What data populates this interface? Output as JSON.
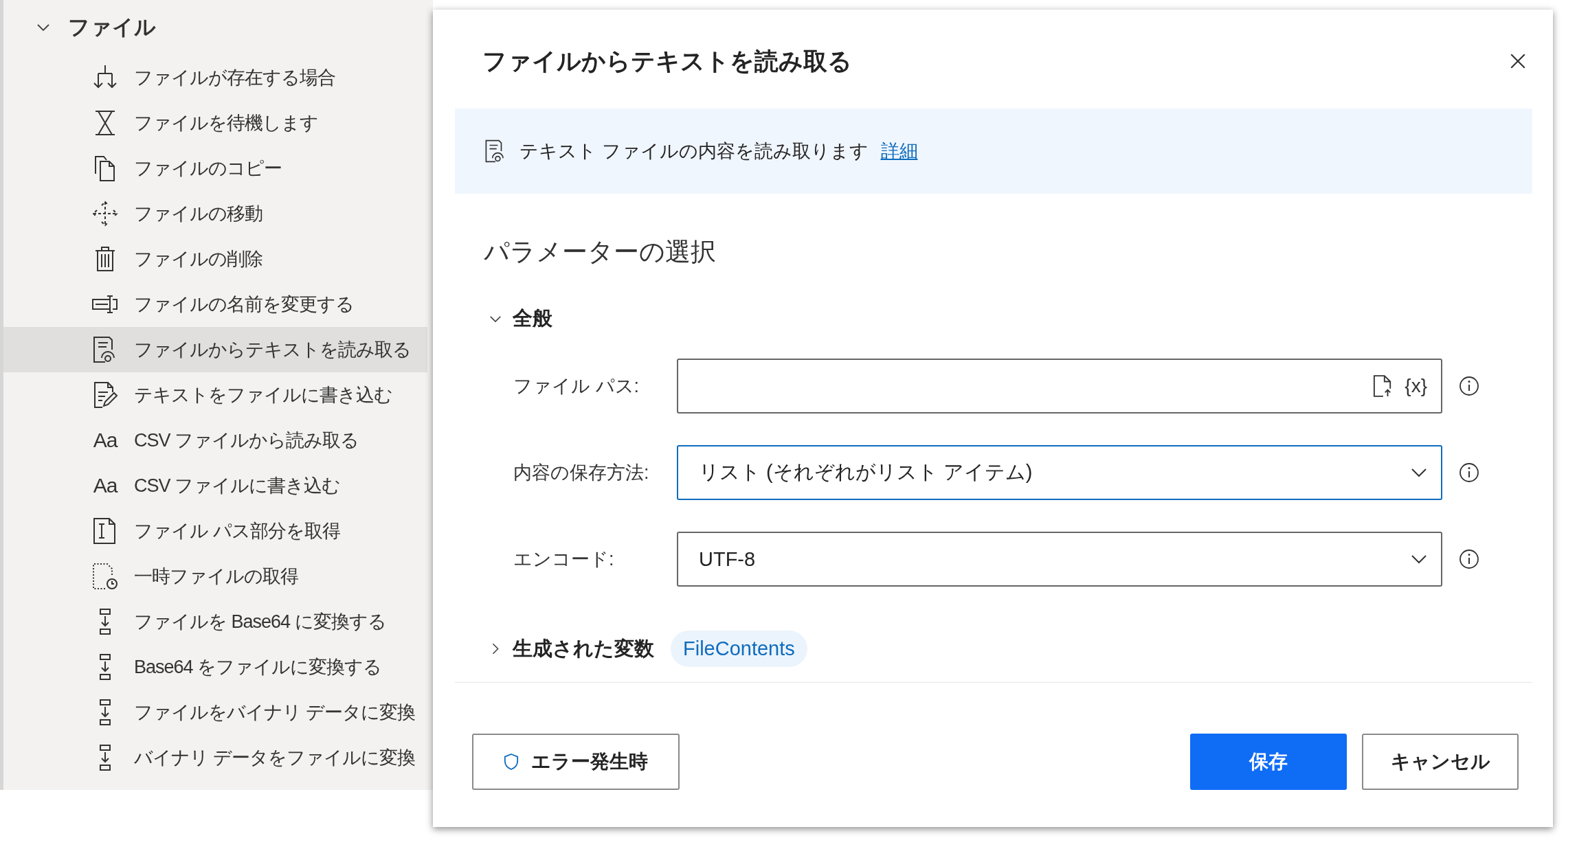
{
  "sidebar": {
    "group": {
      "label": "ファイル",
      "expanded": true
    },
    "items": [
      {
        "label": "ファイルが存在する場合",
        "kind": "branch",
        "selected": false
      },
      {
        "label": "ファイルを待機します",
        "kind": "hourglass",
        "selected": false
      },
      {
        "label": "ファイルのコピー",
        "kind": "copy",
        "selected": false
      },
      {
        "label": "ファイルの移動",
        "kind": "move",
        "selected": false
      },
      {
        "label": "ファイルの削除",
        "kind": "trash",
        "selected": false
      },
      {
        "label": "ファイルの名前を変更する",
        "kind": "rename",
        "selected": false
      },
      {
        "label": "ファイルからテキストを読み取る",
        "kind": "read",
        "selected": true
      },
      {
        "label": "テキストをファイルに書き込む",
        "kind": "write",
        "selected": false
      },
      {
        "label": "CSV ファイルから読み取る",
        "kind": "glyph",
        "glyph": "Aa",
        "selected": false
      },
      {
        "label": "CSV ファイルに書き込む",
        "kind": "glyph",
        "glyph": "Aa",
        "selected": false
      },
      {
        "label": "ファイル パス部分を取得",
        "kind": "path",
        "selected": false
      },
      {
        "label": "一時ファイルの取得",
        "kind": "temp",
        "selected": false
      },
      {
        "label": "ファイルを Base64 に変換する",
        "kind": "convert",
        "selected": false
      },
      {
        "label": "Base64 をファイルに変換する",
        "kind": "convert",
        "selected": false
      },
      {
        "label": "ファイルをバイナリ データに変換",
        "kind": "convert",
        "selected": false
      },
      {
        "label": "バイナリ データをファイルに変換",
        "kind": "convert",
        "selected": false
      }
    ]
  },
  "dialog": {
    "title": "ファイルからテキストを読み取る",
    "banner": {
      "text": "テキスト ファイルの内容を読み取ります",
      "link": "詳細"
    },
    "section_title": "パラメーターの選択",
    "group": {
      "label": "全般",
      "expanded": true
    },
    "fields": [
      {
        "label": "ファイル パス:",
        "kind": "text",
        "variable_button": "{x}",
        "focused": false
      },
      {
        "label": "内容の保存方法:",
        "kind": "select",
        "value": "リスト (それぞれがリスト アイテム)",
        "focused": true
      },
      {
        "label": "エンコード:",
        "kind": "select",
        "value": "UTF-8",
        "focused": false
      }
    ],
    "variables": {
      "label": "生成された変数",
      "expanded": false,
      "chips": [
        "FileContents"
      ]
    },
    "buttons": {
      "error": "エラー発生時",
      "actions": [
        {
          "label": "保存",
          "kind": "primary"
        },
        {
          "label": "キャンセル",
          "kind": "secondary"
        }
      ]
    }
  }
}
